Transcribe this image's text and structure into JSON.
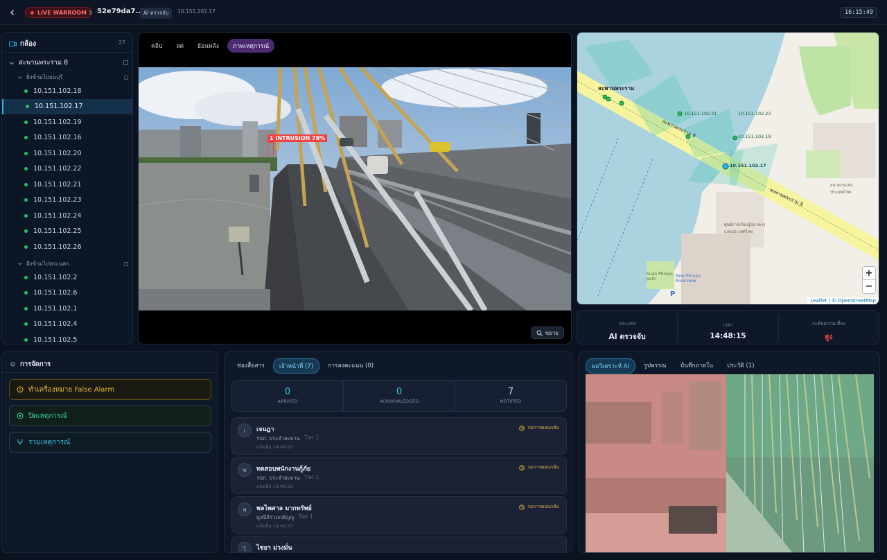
{
  "header": {
    "back_icon": "chevron-left-icon",
    "live_badge": "LIVE WARROOM",
    "incident_id": "52e79da7...",
    "ai_badge": "AI ตรวจจับ",
    "ip": "10.151.102.17",
    "clock": "16:15:49",
    "colors": {
      "live": "#ef4444",
      "accent": "#22b8e6"
    }
  },
  "camera_tree": {
    "title": "กล้อง",
    "count": "27",
    "group": "สะพานพระราม 8",
    "subgroup1": "ฝั่งข้ามไปธนบุรี",
    "cams1": [
      "10.151.102.18",
      "10.151.102.17",
      "10.151.102.19",
      "10.151.102.16",
      "10.151.102.20",
      "10.151.102.22",
      "10.151.102.21",
      "10.151.102.23",
      "10.151.102.24",
      "10.151.102.25",
      "10.151.102.26"
    ],
    "subgroup2": "ฝั่งข้ามไปพระนคร",
    "cams2": [
      "10.151.102.2",
      "10.151.102.6",
      "10.151.102.1",
      "10.151.102.4",
      "10.151.102.5"
    ],
    "active_index": 1
  },
  "video": {
    "tabs": [
      "คลิป",
      "สด",
      "ย้อนหลัง",
      "ภาพเหตุการณ์"
    ],
    "active_tab": 3,
    "detection_label": "1 INTRUSION 78%",
    "expand_label": "ขยาย"
  },
  "map": {
    "bridge_label": "สะพานพระราม",
    "road_label": "สะพานพระราม 8",
    "road_label2": "สะพานพระราม 8",
    "cams": [
      "10.151.102.21",
      "10.151.102.23",
      "10.151.102.19",
      "10.151.102.17"
    ],
    "place1": "Suan Phraya park",
    "place2": "New Phraya Riverview",
    "place3": "ศูนย์การเรียนรู้ธนาคารแห่งประเทศไทย",
    "place4": "ธนาคารแห่งประเทศไทย",
    "zoom_in": "+",
    "zoom_out": "−",
    "attribution": "Leaflet | © OpenStreetMap",
    "pin": "P"
  },
  "info": {
    "type_label": "ประเภท",
    "type_value": "AI ตรวจจับ",
    "time_label": "เวลา",
    "time_value": "14:48:15",
    "risk_label": "ระดับความเสี่ยง",
    "risk_value": "สูง",
    "risk_color": "#ef4444"
  },
  "actions": {
    "title": "การจัดการ",
    "false_alarm": "ทำเครื่องหมาย False Alarm",
    "close_incident": "ปิดเหตุการณ์",
    "merge_incident": "รวมเหตุการณ์"
  },
  "comms": {
    "tabs": [
      "ช่องสื่อสาร",
      "เจ้าหน้าที่ (7)",
      "การลงคะแนน (0)"
    ],
    "active_tab": 1,
    "stats": [
      {
        "value": "0",
        "label": "ARRIVED"
      },
      {
        "value": "0",
        "label": "ACKNOWLEDGED"
      },
      {
        "value": "7",
        "label": "NOTIFIED"
      }
    ],
    "staff": [
      {
        "initial": "เ",
        "name": "เจนฎา",
        "role": "รปภ. ประจำสะพาน",
        "tier": "Tier 1",
        "time": "แจ้งเมื่อ 14:49:32",
        "status": "รอการตอบกลับ"
      },
      {
        "initial": "ท",
        "name": "ทดสอบพนักงานกู้ภัย",
        "role": "รปภ. ประจำสะพาน",
        "tier": "Tier 1",
        "time": "แจ้งเมื่อ 14:49:33",
        "status": "รอการตอบกลับ"
      },
      {
        "initial": "พ",
        "name": "พลไพศาล มากทรัพย์",
        "role": "มูลนิธิร่วมกตัญญู",
        "tier": "Tier 1",
        "time": "แจ้งเมื่อ 14:49:33",
        "status": "รอการตอบกลับ"
      },
      {
        "initial": "ไ",
        "name": "ไชยา ม่วงมั่น",
        "role": "",
        "tier": "",
        "time": "",
        "status": ""
      }
    ]
  },
  "analysis": {
    "tabs": [
      "ผลวิเคราะห์ AI",
      "รูปพรรณ",
      "บันทึกภายใน",
      "ประวัติ (1)"
    ],
    "active_tab": 0
  }
}
